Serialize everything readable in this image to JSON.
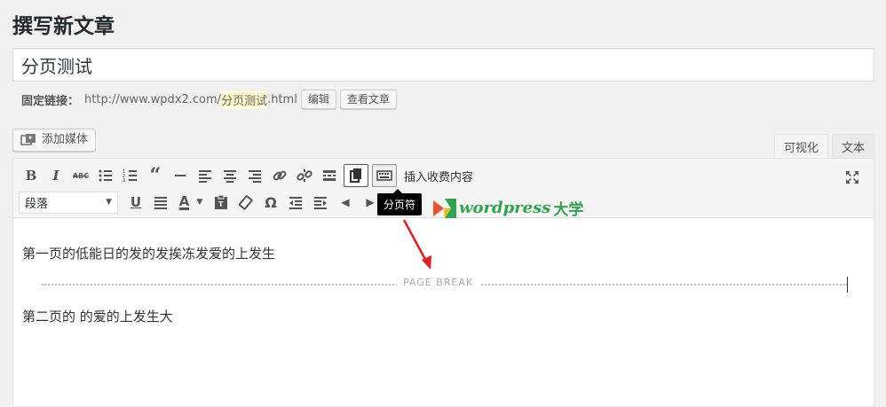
{
  "page": {
    "title": "撰写新文章"
  },
  "post": {
    "title_value": "分页测试",
    "permalink_label": "固定链接：",
    "permalink_url": "http://www.wpdx2.com/",
    "permalink_slug": "分页测试",
    "permalink_ext": ".html",
    "edit_label": "编辑",
    "view_label": "查看文章"
  },
  "media": {
    "add_label": "添加媒体"
  },
  "tabs": {
    "visual": "可视化",
    "text": "文本"
  },
  "toolbar": {
    "insert_paid_label": "插入收费内容",
    "format_select": "段落",
    "tooltip": "分页符"
  },
  "content": {
    "para1": "第一页的低能日的发的发挨冻发爱的上发生",
    "page_break": "PAGE BREAK",
    "para2": "第二页的  的爱的上发生大"
  },
  "watermark": {
    "latin": "wordpress",
    "cn": "大学"
  },
  "colors": {
    "accent": "#2ea44f",
    "arrow": "#e02020",
    "page_break": "#aaaaaa"
  }
}
